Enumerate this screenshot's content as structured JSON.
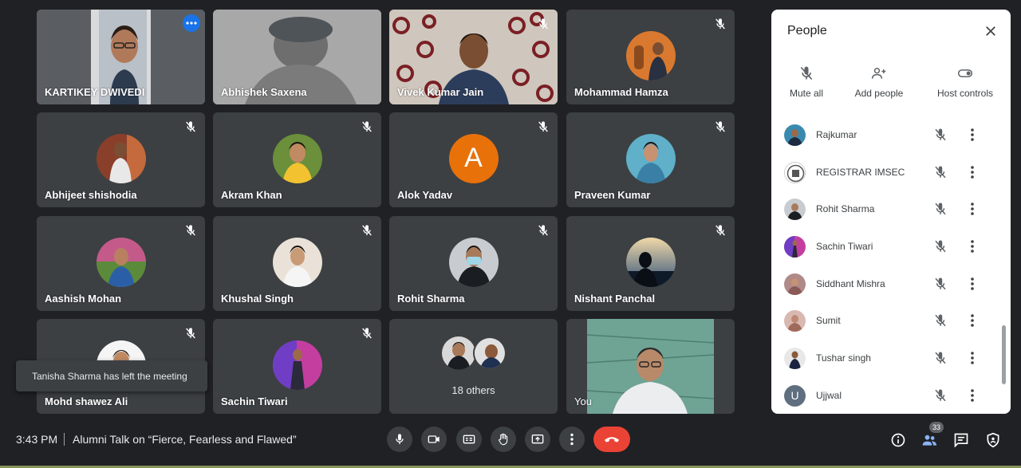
{
  "tiles": [
    {
      "name": "KARTIKEY DWIVEDI"
    },
    {
      "name": "Abhishek Saxena"
    },
    {
      "name": "Vivek Kumar Jain"
    },
    {
      "name": "Mohammad Hamza"
    },
    {
      "name": "Abhijeet shishodia"
    },
    {
      "name": "Akram Khan"
    },
    {
      "name": "Alok Yadav",
      "initial": "A"
    },
    {
      "name": "Praveen Kumar"
    },
    {
      "name": "Aashish Mohan"
    },
    {
      "name": "Khushal Singh"
    },
    {
      "name": "Rohit Sharma"
    },
    {
      "name": "Nishant Panchal"
    },
    {
      "name": "Mohd shawez Ali"
    },
    {
      "name": "Sachin Tiwari"
    },
    {
      "name": "18 others"
    },
    {
      "name": "You"
    }
  ],
  "toast": {
    "text": "Tanisha Sharma has left the meeting"
  },
  "panel": {
    "title": "People",
    "actions": {
      "mute_all": "Mute all",
      "add_people": "Add people",
      "host_controls": "Host controls"
    },
    "participants": [
      {
        "name": "Rajkumar"
      },
      {
        "name": "REGISTRAR IMSEC"
      },
      {
        "name": "Rohit Sharma"
      },
      {
        "name": "Sachin Tiwari"
      },
      {
        "name": "Siddhant Mishra"
      },
      {
        "name": "Sumit"
      },
      {
        "name": "Tushar singh"
      },
      {
        "name": "Ujjwal",
        "initial": "U"
      }
    ]
  },
  "bottom": {
    "time": "3:43 PM",
    "meeting_title": "Alumni Talk on “Fierce, Fearless and Flawed”",
    "participant_count": "33"
  },
  "colors": {
    "accent": "#8ab4f8",
    "hangup": "#ea4335",
    "alok_avatar": "#e8710a"
  }
}
